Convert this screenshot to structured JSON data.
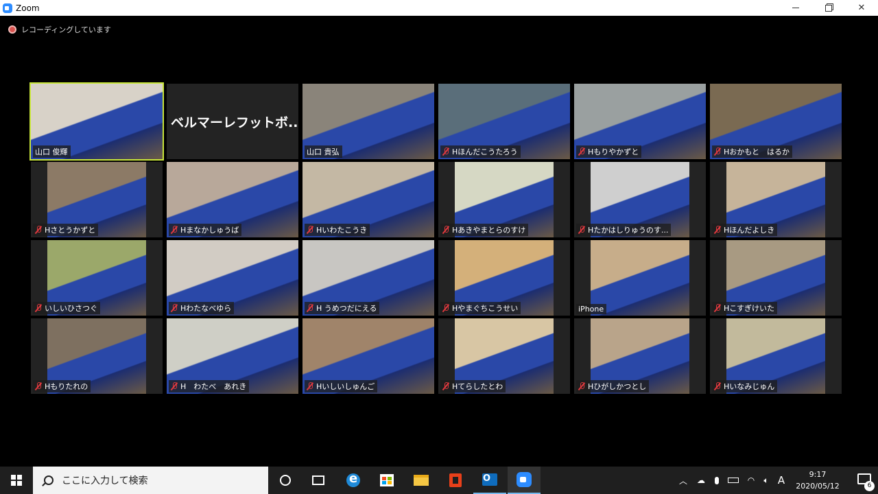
{
  "window": {
    "title": "Zoom"
  },
  "recording": {
    "text": "レコーディングしています"
  },
  "participants": [
    {
      "name": "山口 俊輝",
      "muted": false,
      "bg": "#d8d2c8",
      "active": true
    },
    {
      "name": "ベルマーレフットボ...",
      "muted": false,
      "bg": "",
      "name_only": true
    },
    {
      "name": "山口 貴弘",
      "muted": false,
      "bg": "#8a847a"
    },
    {
      "name": "Hほんだこうたろう",
      "muted": true,
      "bg": "#5a6e7a"
    },
    {
      "name": "Hもりやかずと",
      "muted": true,
      "bg": "#9aa0a0"
    },
    {
      "name": "Hおかもと　はるか",
      "muted": true,
      "bg": "#7a6a52"
    },
    {
      "name": "Hさとうかずと",
      "muted": true,
      "bg": "#8c7a66"
    },
    {
      "name": "Hまなかしゅうば",
      "muted": true,
      "bg": "#b8a89a"
    },
    {
      "name": "Hいわたこうき",
      "muted": true,
      "bg": "#c4b8a4"
    },
    {
      "name": "Hあきやまとらのすけ",
      "muted": true,
      "bg": "#d6d8c4"
    },
    {
      "name": "Hたかはしりゅうのす...",
      "muted": true,
      "bg": "#cfcfcf"
    },
    {
      "name": "Hほんだよしき",
      "muted": true,
      "bg": "#c6b49a"
    },
    {
      "name": "いしいひさつぐ",
      "muted": true,
      "bg": "#9ba86a"
    },
    {
      "name": "Hわたなべゆら",
      "muted": true,
      "bg": "#d2ccc4"
    },
    {
      "name": "H うめつだにえる",
      "muted": true,
      "bg": "#c8c6c2"
    },
    {
      "name": "Hやまぐちこうせい",
      "muted": true,
      "bg": "#d4b07a"
    },
    {
      "name": "iPhone",
      "muted": false,
      "bg": "#c7ad8a"
    },
    {
      "name": "Hこすぎけいた",
      "muted": true,
      "bg": "#a89a82"
    },
    {
      "name": "Hもりたれの",
      "muted": true,
      "bg": "#7e7060"
    },
    {
      "name": "H　わたべ　あれき",
      "muted": true,
      "bg": "#cfcfc6"
    },
    {
      "name": "Hいしいしゅんご",
      "muted": true,
      "bg": "#a0846a"
    },
    {
      "name": "Hてらしたとわ",
      "muted": true,
      "bg": "#d8c6a4"
    },
    {
      "name": "Hひがしかつとし",
      "muted": true,
      "bg": "#b9a48a"
    },
    {
      "name": "Hいなみじゅん",
      "muted": true,
      "bg": "#c2ba9c"
    }
  ],
  "taskbar": {
    "search_placeholder": "ここに入力して検索",
    "apps": [
      "cortana-icon",
      "task-view-icon",
      "edge-icon",
      "store-icon",
      "file-explorer-icon",
      "office-icon",
      "outlook-icon",
      "zoom-icon"
    ],
    "time": "9:17",
    "date": "2020/05/12",
    "ime": "A",
    "notifications": "6"
  }
}
